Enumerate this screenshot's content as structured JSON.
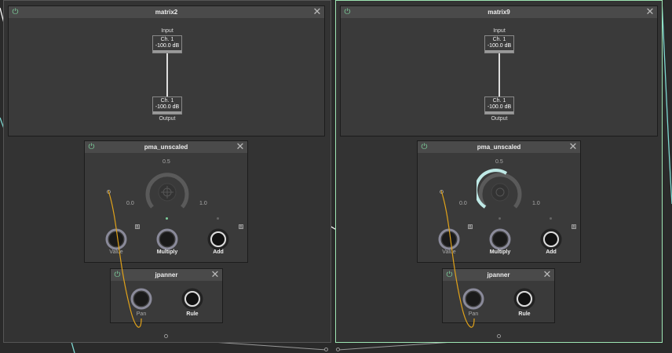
{
  "colors": {
    "wire_white": "#ffffff",
    "wire_cyan": "#7fd9d2",
    "wire_orange": "#e0a21a",
    "selected_border": "#9ee6b4",
    "power": "#7ccf9b"
  },
  "groups": [
    {
      "matrix": {
        "title": "matrix2",
        "input_label": "Input",
        "output_label": "Output",
        "input": {
          "channel": "Ch. 1",
          "value": "-100.0 dB"
        },
        "output": {
          "channel": "Ch. 1",
          "value": "-100.0 dB"
        }
      },
      "pma": {
        "title": "pma_unscaled",
        "scale_top": "0.5",
        "scale_min": "0.0",
        "scale_max": "1.0",
        "value_label": "Value",
        "multiply_label": "Multiply",
        "add_label": "Add",
        "box_label": "B",
        "arc_fraction": 0.0
      },
      "jpanner": {
        "title": "jpanner",
        "pan_label": "Pan",
        "rule_label": "Rule"
      }
    },
    {
      "matrix": {
        "title": "matrix9",
        "input_label": "Input",
        "output_label": "Output",
        "input": {
          "channel": "Ch. 1",
          "value": "-100.0 dB"
        },
        "output": {
          "channel": "Ch. 1",
          "value": "-100.0 dB"
        }
      },
      "pma": {
        "title": "pma_unscaled",
        "scale_top": "0.5",
        "scale_min": "0.0",
        "scale_max": "1.0",
        "value_label": "Value",
        "multiply_label": "Multiply",
        "add_label": "Add",
        "box_label": "B",
        "arc_fraction": 0.45
      },
      "jpanner": {
        "title": "jpanner",
        "pan_label": "Pan",
        "rule_label": "Rule"
      }
    }
  ]
}
